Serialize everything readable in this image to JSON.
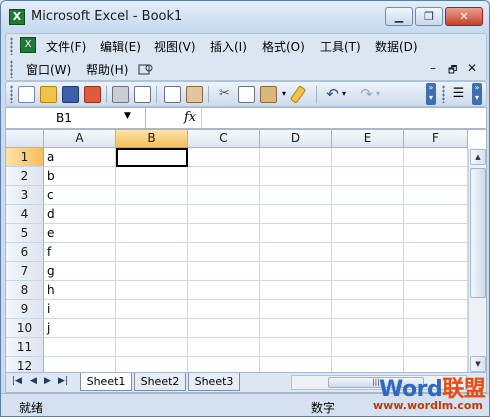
{
  "window": {
    "title": "Microsoft Excel - Book1",
    "min": "▁",
    "max": "❐",
    "close": "✕"
  },
  "menus": [
    {
      "label": "文件(F)",
      "name": "menu-file"
    },
    {
      "label": "编辑(E)",
      "name": "menu-edit"
    },
    {
      "label": "视图(V)",
      "name": "menu-view"
    },
    {
      "label": "插入(I)",
      "name": "menu-insert"
    },
    {
      "label": "格式(O)",
      "name": "menu-format"
    },
    {
      "label": "工具(T)",
      "name": "menu-tools"
    },
    {
      "label": "数据(D)",
      "name": "menu-data"
    },
    {
      "label": "窗口(W)",
      "name": "menu-window"
    },
    {
      "label": "帮助(H)",
      "name": "menu-help"
    }
  ],
  "menu_right": {
    "minimize": "–",
    "restore": "🗗",
    "close": "✕"
  },
  "toolbar_icons": [
    "new-icon",
    "open-icon",
    "save-icon",
    "permission-icon",
    "print-icon",
    "print-preview-icon",
    "spelling-icon",
    "research-icon",
    "cut-icon",
    "copy-icon",
    "paste-icon",
    "format-painter-icon",
    "undo-icon",
    "redo-icon"
  ],
  "formula_bar": {
    "name_box": "B1",
    "fx": "fx",
    "formula": ""
  },
  "columns": [
    "A",
    "B",
    "C",
    "D",
    "E",
    "F"
  ],
  "rows": [
    "1",
    "2",
    "3",
    "4",
    "5",
    "6",
    "7",
    "8",
    "9",
    "10",
    "11",
    "12"
  ],
  "column_a_values": [
    "a",
    "b",
    "c",
    "d",
    "e",
    "f",
    "g",
    "h",
    "i",
    "j",
    "",
    ""
  ],
  "selected_cell": "B1",
  "sheet_tabs": [
    "Sheet1",
    "Sheet2",
    "Sheet3"
  ],
  "active_sheet": "Sheet1",
  "hscroll_grip": "|||",
  "status": {
    "ready": "就绪",
    "mode": "数字"
  },
  "watermark": {
    "brand_a": "Word",
    "brand_b": "联盟",
    "url": "www.wordlm.com"
  }
}
